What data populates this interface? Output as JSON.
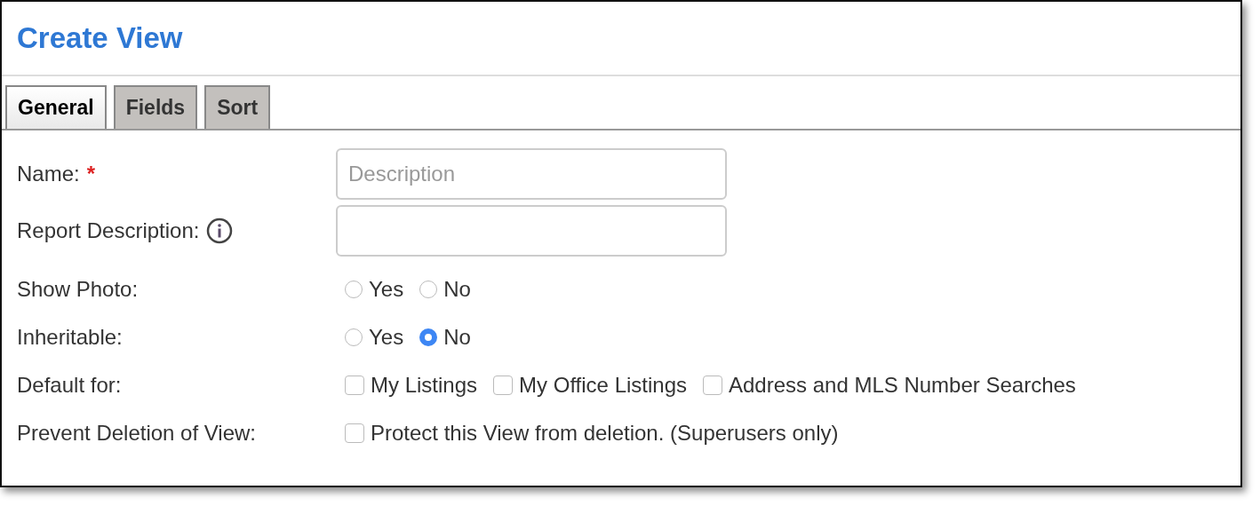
{
  "title": "Create View",
  "tabs": [
    {
      "label": "General",
      "selected": true
    },
    {
      "label": "Fields",
      "selected": false
    },
    {
      "label": "Sort",
      "selected": false
    }
  ],
  "rows": [
    {
      "kind": "text",
      "label": "Name:",
      "required_mark": "*",
      "placeholder": "Description"
    },
    {
      "kind": "text",
      "label": "Report Description:",
      "info": true
    },
    {
      "kind": "radio",
      "label": "Show Photo:",
      "options": [
        {
          "label": "Yes",
          "selected": false
        },
        {
          "label": "No",
          "selected": false
        }
      ]
    },
    {
      "kind": "radio",
      "label": "Inheritable:",
      "options": [
        {
          "label": "Yes",
          "selected": false
        },
        {
          "label": "No",
          "selected": true
        }
      ]
    },
    {
      "kind": "checkbox",
      "label": "Default for:",
      "options": [
        {
          "label": "My Listings",
          "checked": false
        },
        {
          "label": "My Office Listings",
          "checked": false
        },
        {
          "label": "Address and MLS Number Searches",
          "checked": false
        }
      ]
    },
    {
      "kind": "checkbox",
      "label": "Prevent Deletion of View:",
      "options": [
        {
          "label": "Protect this View from deletion. (Superusers only)",
          "checked": false
        }
      ]
    }
  ]
}
